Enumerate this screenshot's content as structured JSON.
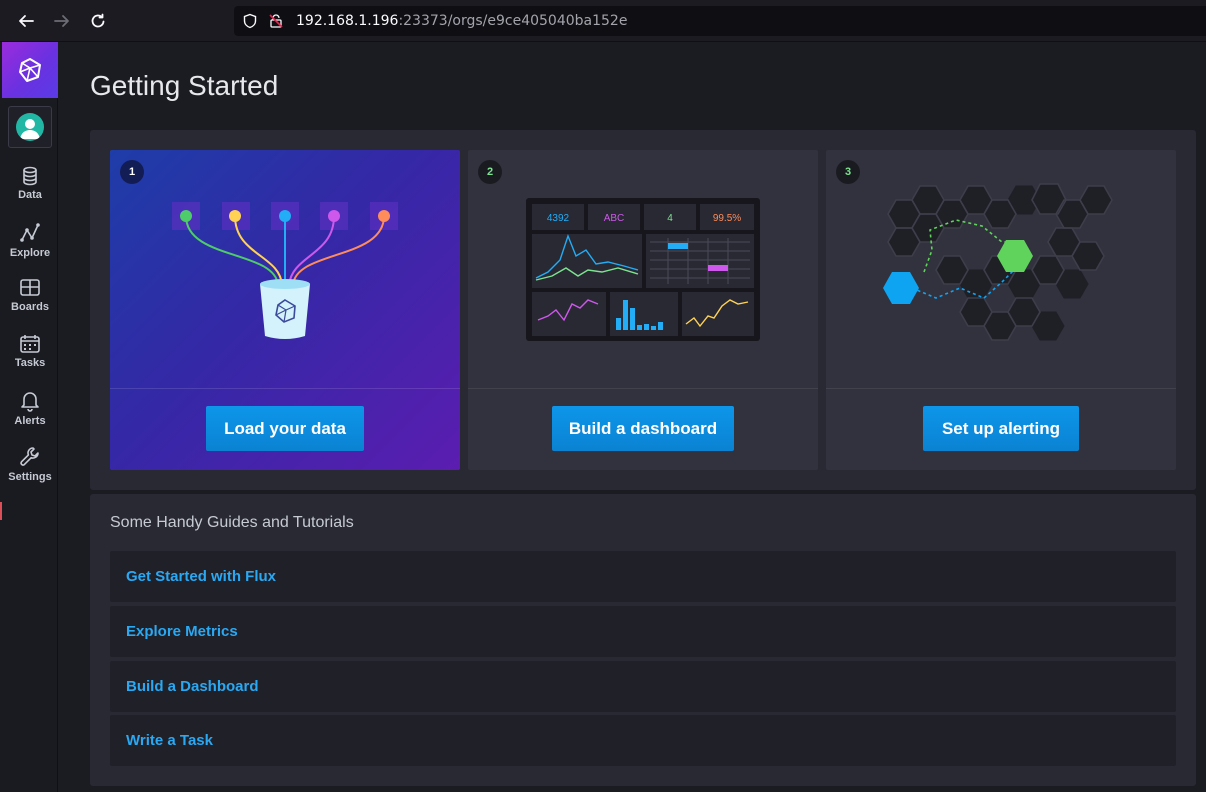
{
  "browser": {
    "url_host": "192.168.1.196",
    "url_rest": ":23373/orgs/e9ce405040ba152e"
  },
  "sidebar": {
    "items": [
      {
        "label": "Data",
        "icon": "database-icon"
      },
      {
        "label": "Explore",
        "icon": "explore-graph-icon"
      },
      {
        "label": "Boards",
        "icon": "dashboards-grid-icon"
      },
      {
        "label": "Tasks",
        "icon": "calendar-icon"
      },
      {
        "label": "Alerts",
        "icon": "bell-icon"
      },
      {
        "label": "Settings",
        "icon": "wrench-icon"
      }
    ]
  },
  "page": {
    "title": "Getting Started"
  },
  "steps": [
    {
      "number": "1",
      "button": "Load your data"
    },
    {
      "number": "2",
      "button": "Build a dashboard",
      "stats": [
        "4392",
        "ABC",
        "4",
        "99.5%"
      ]
    },
    {
      "number": "3",
      "button": "Set up alerting"
    }
  ],
  "guides": {
    "heading": "Some Handy Guides and Tutorials",
    "links": [
      "Get Started with Flux",
      "Explore Metrics",
      "Build a Dashboard",
      "Write a Task"
    ]
  },
  "colors": {
    "accent_blue": "#0b8ee0",
    "link_blue": "#2aa8f2",
    "green": "#5fd35b",
    "purple": "#c165e3"
  }
}
